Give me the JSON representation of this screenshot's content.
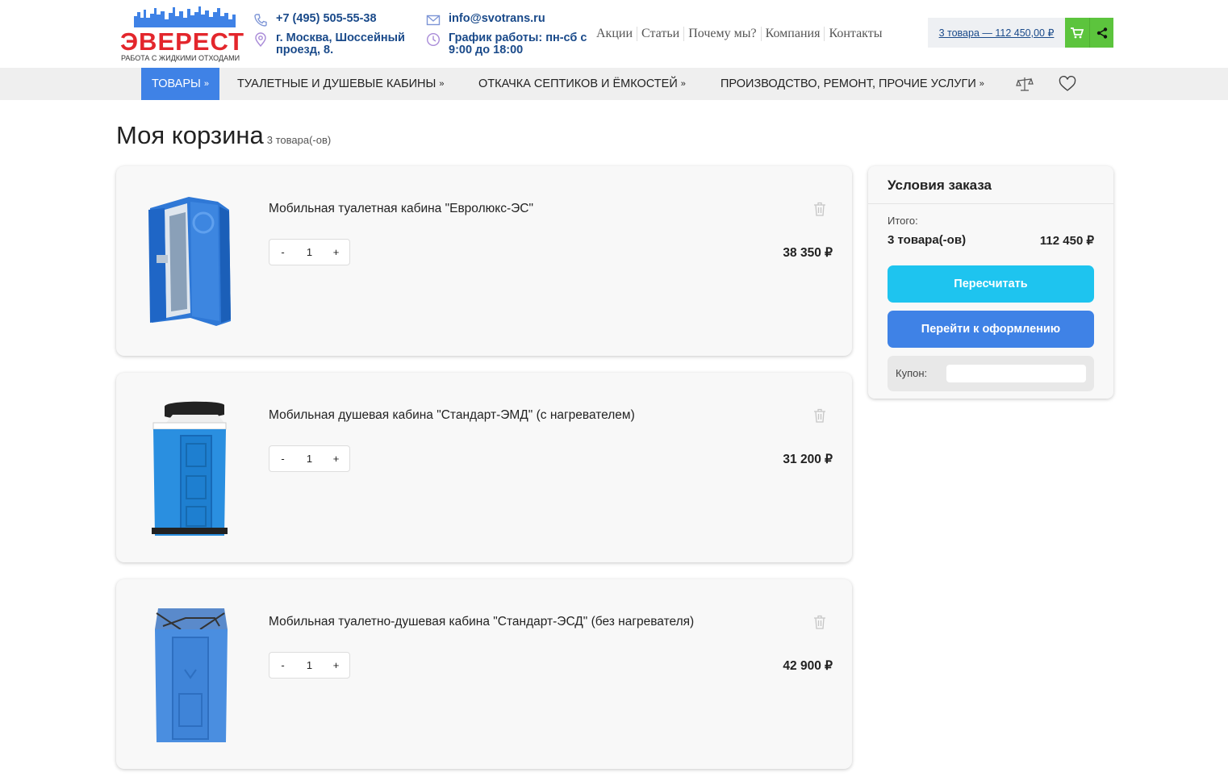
{
  "header": {
    "logo_text": "ЭВЕРЕСТ",
    "logo_subtitle": "РАБОТА С ЖИДКИМИ ОТХОДАМИ",
    "phone": "+7 (495) 505-55-38",
    "address": "г. Москва, Шоссейный проезд, 8.",
    "email": "info@svotrans.ru",
    "hours": "График работы: пн-сб с 9:00 до 18:00",
    "nav": [
      "Акции",
      "Статьи",
      "Почему мы?",
      "Компания",
      "Контакты"
    ],
    "cart_summary": "3 товара — 112 450,00 ₽",
    "icons": {
      "phone": "phone-icon",
      "address": "location-pin-icon",
      "email": "mail-icon",
      "hours": "clock-icon",
      "cart": "cart-icon",
      "share": "share-icon"
    }
  },
  "menu": {
    "items": [
      "ТОВАРЫ",
      "ТУАЛЕТНЫЕ И ДУШЕВЫЕ КАБИНЫ",
      "ОТКАЧКА СЕПТИКОВ И ЁМКОСТЕЙ",
      "ПРОИЗВОДСТВО, РЕМОНТ, ПРОЧИЕ УСЛУГИ"
    ],
    "arrow": "»",
    "icons": [
      "compare-icon",
      "heart-icon"
    ]
  },
  "cart": {
    "title": "Моя корзина",
    "count_label": "3 товара(-ов)",
    "items": [
      {
        "name": "Мобильная туалетная кабина \"Евролюкс-ЭС\"",
        "qty": "1",
        "price": "38 350 ₽",
        "image": "toilet-cabin-image"
      },
      {
        "name": "Мобильная душевая кабина \"Стандарт-ЭМД\" (с нагревателем)",
        "qty": "1",
        "price": "31 200 ₽",
        "image": "shower-cabin-image"
      },
      {
        "name": "Мобильная туалетно-душевая кабина \"Стандарт-ЭСД\" (без нагревателя)",
        "qty": "1",
        "price": "42 900 ₽",
        "image": "toilet-shower-cabin-image"
      }
    ],
    "minus": "-",
    "plus": "+"
  },
  "summary": {
    "title": "Условия заказа",
    "total_label": "Итого:",
    "count": "3 товара(-ов)",
    "total": "112 450 ₽",
    "recalc_button": "Пересчитать",
    "order_button": "Перейти к оформлению",
    "coupon_label": "Купон:",
    "coupon_value": ""
  },
  "colors": {
    "accent_blue": "#3f82e6",
    "cyan": "#1ec4ef",
    "green": "#5cc43d",
    "logo_red": "#e3262c",
    "link_blue": "#1a4a8a"
  }
}
